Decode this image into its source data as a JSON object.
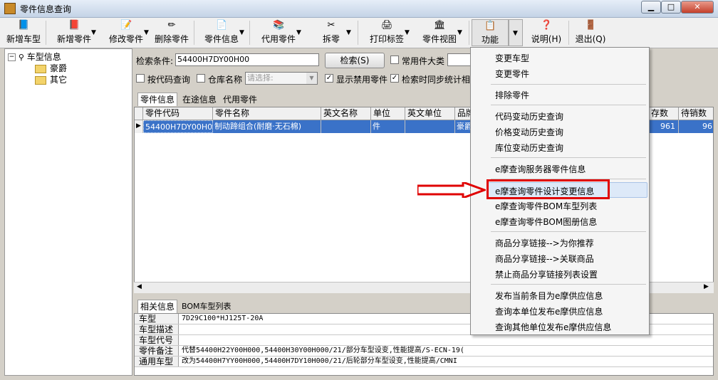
{
  "window": {
    "title": "零件信息查询",
    "min": "▁",
    "max": "□",
    "close": "✕"
  },
  "toolbar": {
    "items": [
      {
        "label": "新增车型",
        "icon": "add-model-icon"
      },
      {
        "label": "新增零件",
        "icon": "add-part-icon"
      },
      {
        "label": "修改零件",
        "icon": "edit-part-icon"
      },
      {
        "label": "删除零件",
        "icon": "delete-part-icon"
      },
      {
        "label": "零件信息",
        "icon": "part-info-icon"
      },
      {
        "label": "代用零件",
        "icon": "substitute-part-icon"
      },
      {
        "label": "拆零",
        "icon": "scissors-icon"
      },
      {
        "label": "打印标签",
        "icon": "print-icon"
      },
      {
        "label": "零件视图",
        "icon": "view-icon"
      },
      {
        "label": "功能",
        "icon": "function-icon"
      },
      {
        "label": "说明(H)",
        "icon": "help-icon"
      },
      {
        "label": "退出(Q)",
        "icon": "exit-icon"
      }
    ]
  },
  "tree": {
    "root": "车型信息",
    "children": [
      "豪爵",
      "其它"
    ]
  },
  "search": {
    "label": "检索条件:",
    "value": "54400H7DY00H00",
    "button": "检索(S)",
    "common_category_label": "常用件大类",
    "by_code_label": "按代码查询",
    "warehouse_label": "仓库名称",
    "warehouse_placeholder": "请选择:",
    "show_disabled_label": "显示禁用零件",
    "sync_stats_label": "检索时同步统计相"
  },
  "tabs": [
    "零件信息",
    "在途信息",
    "代用零件"
  ],
  "grid": {
    "columns": [
      "零件代码",
      "零件名称",
      "英文名称",
      "单位",
      "英文单位",
      "品牌",
      "存数",
      "待销数"
    ],
    "row": [
      "54400H7DY00H00",
      "制动蹄组合(耐磨·无石棉)",
      "",
      "件",
      "",
      "豪爵",
      "961",
      "96"
    ]
  },
  "detail_tabs": [
    "相关信息",
    "BOM车型列表"
  ],
  "detail": [
    {
      "key": "车型",
      "value": "7D29C100*HJ125T-20A"
    },
    {
      "key": "车型描述",
      "value": ""
    },
    {
      "key": "车型代号",
      "value": ""
    },
    {
      "key": "零件备注",
      "value": "代替54400H22Y00H000,54400H30Y00H000/21/部分车型设变,性能提高/S-ECN-19("
    },
    {
      "key": "通用车型",
      "value": "改为54400H7YY00H000,54400H7DY10H000/21/后轮部分车型设变,性能提高/CMNI"
    }
  ],
  "menu": {
    "groups": [
      [
        "变更车型",
        "变更零件"
      ],
      [
        "排除零件"
      ],
      [
        "代码变动历史查询",
        "价格变动历史查询",
        "库位变动历史查询"
      ],
      [
        "e摩查询服务器零件信息"
      ],
      [
        "e摩查询零件设计变更信息",
        "e摩查询零件BOM车型列表",
        "e摩查询零件BOM图册信息"
      ],
      [
        "商品分享链接-->为你推荐",
        "商品分享链接-->关联商品",
        "禁止商品分享链接列表设置"
      ],
      [
        "发布当前条目为e摩供应信息",
        "查询本单位发布e摩供应信息",
        "查询其他单位发布e摩供应信息"
      ]
    ],
    "highlighted": "e摩查询零件设计变更信息"
  },
  "colors": {
    "selection": "#3a72c8",
    "highlight_box": "#e00000",
    "arrow": "#e00000"
  }
}
